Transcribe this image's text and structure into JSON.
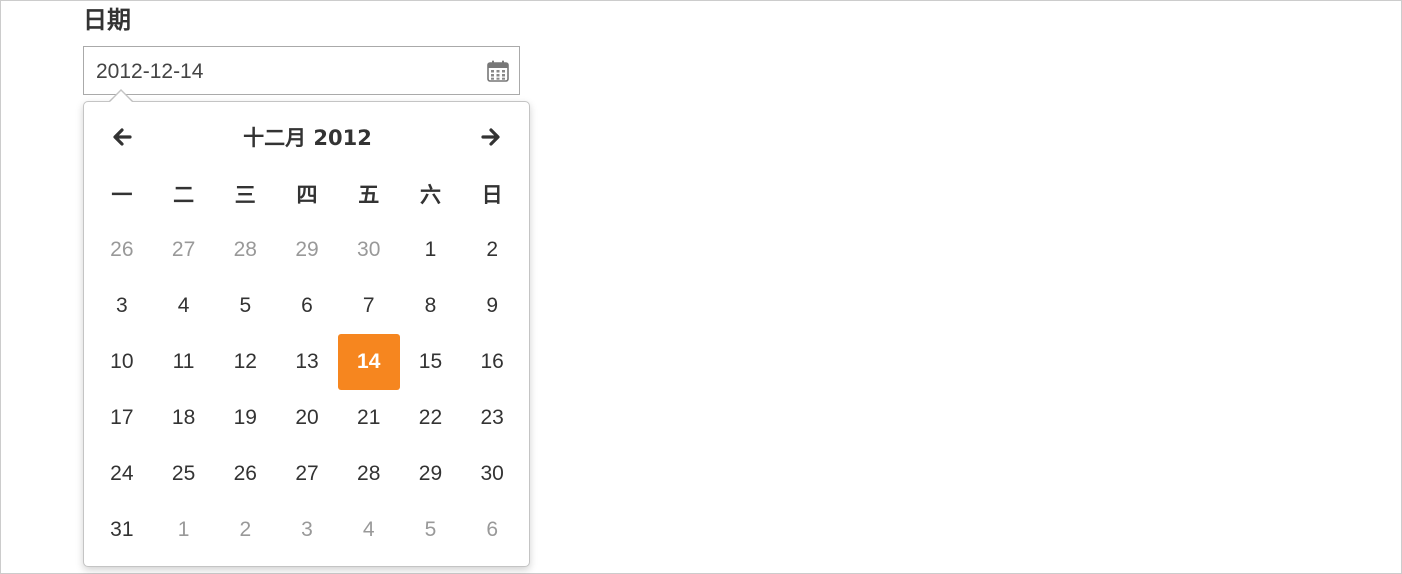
{
  "field": {
    "label": "日期",
    "value": "2012-12-14",
    "icon": "calendar-icon"
  },
  "picker": {
    "title": "十二月 2012",
    "prev_icon": "arrow-left-icon",
    "next_icon": "arrow-right-icon",
    "weekdays": [
      "一",
      "二",
      "三",
      "四",
      "五",
      "六",
      "日"
    ],
    "weeks": [
      [
        {
          "d": "26",
          "m": true
        },
        {
          "d": "27",
          "m": true
        },
        {
          "d": "28",
          "m": true
        },
        {
          "d": "29",
          "m": true
        },
        {
          "d": "30",
          "m": true
        },
        {
          "d": "1"
        },
        {
          "d": "2"
        }
      ],
      [
        {
          "d": "3"
        },
        {
          "d": "4"
        },
        {
          "d": "5"
        },
        {
          "d": "6"
        },
        {
          "d": "7"
        },
        {
          "d": "8"
        },
        {
          "d": "9"
        }
      ],
      [
        {
          "d": "10"
        },
        {
          "d": "11"
        },
        {
          "d": "12"
        },
        {
          "d": "13"
        },
        {
          "d": "14",
          "s": true
        },
        {
          "d": "15"
        },
        {
          "d": "16"
        }
      ],
      [
        {
          "d": "17"
        },
        {
          "d": "18"
        },
        {
          "d": "19"
        },
        {
          "d": "20"
        },
        {
          "d": "21"
        },
        {
          "d": "22"
        },
        {
          "d": "23"
        }
      ],
      [
        {
          "d": "24"
        },
        {
          "d": "25"
        },
        {
          "d": "26"
        },
        {
          "d": "27"
        },
        {
          "d": "28"
        },
        {
          "d": "29"
        },
        {
          "d": "30"
        }
      ],
      [
        {
          "d": "31"
        },
        {
          "d": "1",
          "m": true
        },
        {
          "d": "2",
          "m": true
        },
        {
          "d": "3",
          "m": true
        },
        {
          "d": "4",
          "m": true
        },
        {
          "d": "5",
          "m": true
        },
        {
          "d": "6",
          "m": true
        }
      ]
    ],
    "colors": {
      "selected": "#f6861f",
      "muted": "#999999",
      "text": "#333333"
    }
  }
}
